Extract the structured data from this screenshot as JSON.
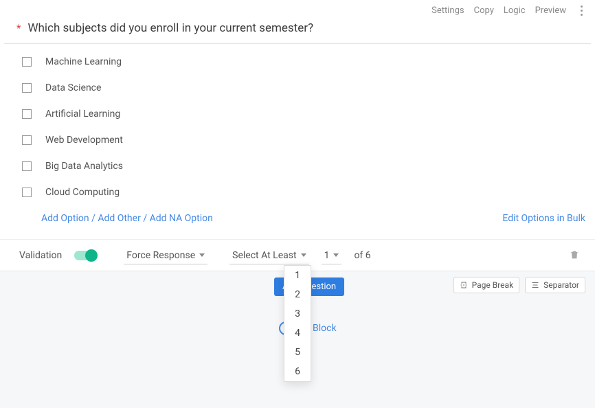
{
  "topbar": {
    "settings": "Settings",
    "copy": "Copy",
    "logic": "Logic",
    "preview": "Preview"
  },
  "question": {
    "required_mark": "*",
    "text": "Which subjects did you enroll in your current semester?"
  },
  "options": [
    "Machine Learning",
    "Data Science",
    "Artificial Learning",
    "Web Development",
    "Big Data Analytics",
    "Cloud  Computing"
  ],
  "option_links": {
    "add_option": "Add Option",
    "sep": " / ",
    "add_other": "Add Other",
    "add_na": "Add NA Option",
    "bulk": "Edit Options in Bulk"
  },
  "validation": {
    "label": "Validation",
    "force": "Force Response",
    "select_at_least": "Select At Least",
    "current": "1",
    "of_label": "of 6",
    "menu": [
      "1",
      "2",
      "3",
      "4",
      "5",
      "6"
    ]
  },
  "buttons": {
    "add_question": "Add Question",
    "page_break": "Page Break",
    "separator": "Separator",
    "block": "Block"
  }
}
